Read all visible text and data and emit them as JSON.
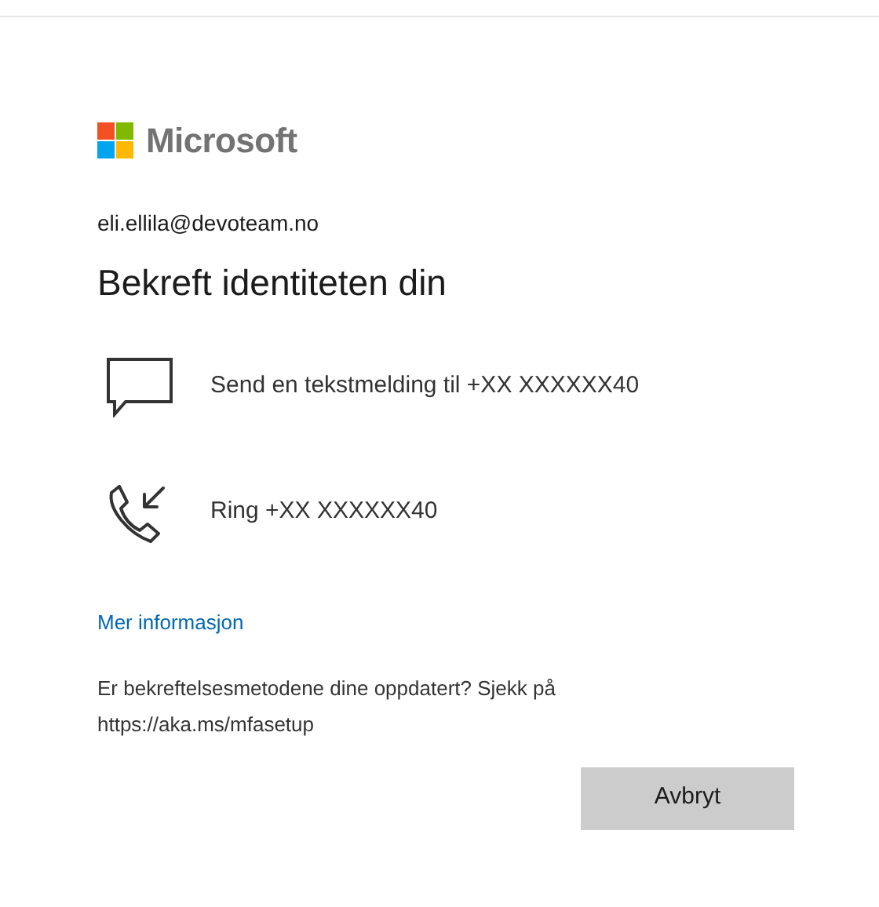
{
  "brand": {
    "name": "Microsoft"
  },
  "account": "eli.ellila@devoteam.no",
  "title": "Bekreft identiteten din",
  "options": [
    {
      "kind": "sms",
      "label": "Send en tekstmelding til +XX XXXXXX40"
    },
    {
      "kind": "call",
      "label": "Ring +XX XXXXXX40"
    }
  ],
  "more_info_link": "Mer informasjon",
  "note": "Er bekreftelsesmetodene dine oppdatert? Sjekk på https://aka.ms/mfasetup",
  "buttons": [
    {
      "label": "Avbryt"
    }
  ]
}
